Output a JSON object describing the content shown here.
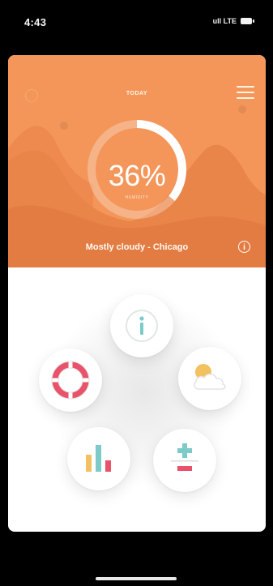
{
  "status_bar": {
    "time": "4:43",
    "network": "ull LTE"
  },
  "header": {
    "title": "TODAY",
    "humidity_value": "36%",
    "humidity_fraction": 0.36,
    "humidity_caption": "HUMIDITY",
    "location": "Mostly cloudy - Chicago",
    "info_symbol": "i"
  },
  "icons": {
    "menu": "hamburger-menu-icon",
    "info": "info-icon",
    "help": "lifebuoy-icon",
    "weather": "partly-cloudy-icon",
    "stats": "bar-chart-icon",
    "calc": "plus-minus-icon"
  },
  "colors": {
    "header_bg": "#f4965a",
    "mountain_back": "#ee8a50",
    "mountain_front": "#e57f47",
    "accent_teal": "#7ccbc9",
    "accent_red": "#e9526a",
    "accent_yellow": "#f2c260"
  }
}
